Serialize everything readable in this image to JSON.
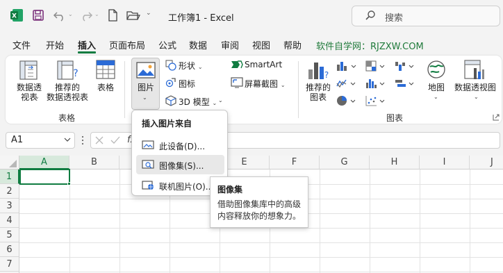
{
  "titlebar": {
    "doc_title": "工作簿1 - Excel",
    "search_placeholder": "搜索"
  },
  "tabs": [
    "文件",
    "开始",
    "插入",
    "页面布局",
    "公式",
    "数据",
    "审阅",
    "视图",
    "帮助"
  ],
  "active_tab": "插入",
  "promo_text": "软件自学网：RJZXW.COM",
  "ribbon": {
    "pivot_table": "数据透\n视表",
    "recommended_pivot": "推荐的\n数据透视表",
    "table": "表格",
    "group_tables": "表格",
    "pictures": "图片",
    "shapes": "形状",
    "icons": "图标",
    "models_3d": "3D 模型",
    "smartart": "SmartArt",
    "screenshot": "屏幕截图",
    "recommended_charts": "推荐的\n图表",
    "maps": "地图",
    "pivot_chart": "数据透视图",
    "group_charts": "图表"
  },
  "formula_bar": {
    "name_box": "A1"
  },
  "sheet": {
    "columns": [
      "A",
      "B",
      "C",
      "D",
      "E",
      "F",
      "G",
      "H",
      "I",
      "J"
    ],
    "rows": [
      "1",
      "2",
      "3",
      "4",
      "5",
      "6",
      "7"
    ]
  },
  "picture_menu": {
    "header": "插入图片来自",
    "items": [
      "此设备(D)...",
      "图像集(S)...",
      "联机图片(O)..."
    ]
  },
  "tooltip": {
    "title": "图像集",
    "body": "借助图像集库中的高级\n内容释放你的想象力。"
  },
  "colors": {
    "excel_green": "#107c41",
    "accent_blue": "#2b6bd6"
  }
}
